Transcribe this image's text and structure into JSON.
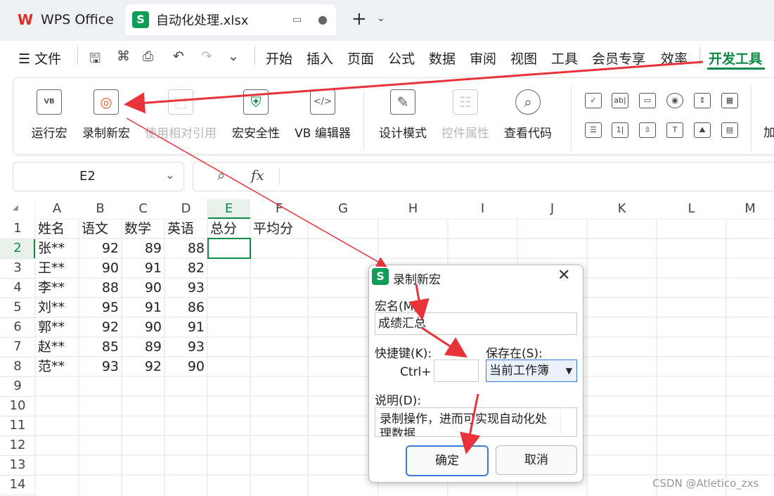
{
  "titlebar": {
    "app_name": "WPS Office",
    "doc_tab": "自动化处理.xlsx",
    "new_tab": "+"
  },
  "menu": {
    "file": "文件",
    "tabs": [
      "开始",
      "插入",
      "页面",
      "公式",
      "数据",
      "审阅",
      "视图",
      "工具",
      "会员专享",
      "效率",
      "开发工具"
    ],
    "active_tab": "开发工具"
  },
  "ribbon": {
    "buttons": [
      {
        "label": "运行宏",
        "icon": "VB"
      },
      {
        "label": "录制新宏",
        "icon": "◎"
      },
      {
        "label": "使用相对引用",
        "icon": "⬚"
      },
      {
        "label": "宏安全性",
        "icon": "⛨"
      },
      {
        "label": "VB 编辑器",
        "icon": "</>"
      },
      {
        "label": "设计模式",
        "icon": "✎"
      },
      {
        "label": "控件属性",
        "icon": "☷"
      },
      {
        "label": "查看代码",
        "icon": "⌕"
      }
    ],
    "controls_row1": [
      "✓",
      "ab|",
      "▭",
      "◉",
      "⇕",
      "▦"
    ],
    "controls_row2": [
      "☰",
      "1|",
      "⇳",
      "T",
      "⛰",
      "▤"
    ],
    "overflow_label": "加"
  },
  "formula_bar": {
    "cell_ref": "E2",
    "fx": "fx"
  },
  "sheet": {
    "columns": [
      "A",
      "B",
      "C",
      "D",
      "E",
      "F",
      "G",
      "H",
      "I",
      "J",
      "K",
      "L",
      "M"
    ],
    "row_numbers": [
      "1",
      "2",
      "3",
      "4",
      "5",
      "6",
      "7",
      "8",
      "9",
      "10",
      "11",
      "12",
      "13",
      "14"
    ],
    "header_row": [
      "姓名",
      "语文",
      "数学",
      "英语",
      "总分",
      "平均分"
    ],
    "rows": [
      [
        "张**",
        "92",
        "89",
        "88"
      ],
      [
        "王**",
        "90",
        "91",
        "82"
      ],
      [
        "李**",
        "88",
        "90",
        "93"
      ],
      [
        "刘**",
        "95",
        "91",
        "86"
      ],
      [
        "郭**",
        "92",
        "90",
        "91"
      ],
      [
        "赵**",
        "85",
        "89",
        "93"
      ],
      [
        "范**",
        "93",
        "92",
        "90"
      ]
    ]
  },
  "dialog": {
    "title": "录制新宏",
    "macro_name_label": "宏名(M):",
    "macro_name_value": "成绩汇总",
    "shortcut_label": "快捷键(K):",
    "shortcut_prefix": "Ctrl+",
    "store_in_label": "保存在(S):",
    "store_in_value": "当前工作簿",
    "description_label": "说明(D):",
    "description_value": "录制操作，进而可实现自动化处理数据",
    "ok_label": "确定",
    "cancel_label": "取消"
  },
  "watermark": "CSDN @Atletico_zxs",
  "colors": {
    "accent_green": "#0f8a45",
    "annotation_red": "#e8333a",
    "primary_button_border": "#3a7bd5"
  }
}
